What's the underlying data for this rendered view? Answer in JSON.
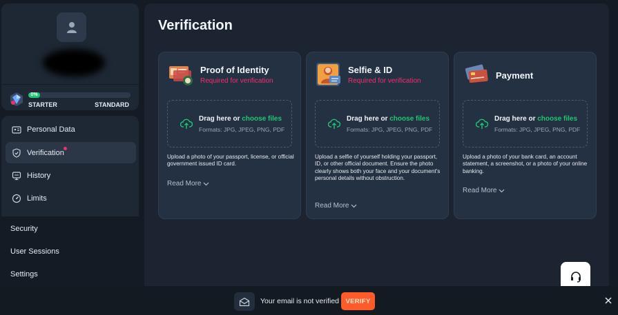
{
  "profile": {
    "level": {
      "progress_label": "0%",
      "progress_fraction": 0.0,
      "start_label": "STARTER",
      "end_label": "STANDARD"
    }
  },
  "sidebar": {
    "items": [
      {
        "label": "Personal Data",
        "icon": "id-card-icon",
        "active": false
      },
      {
        "label": "Verification",
        "icon": "shield-check-icon",
        "active": true
      },
      {
        "label": "History",
        "icon": "monitor-icon",
        "active": false
      },
      {
        "label": "Limits",
        "icon": "gauge-icon",
        "active": false
      }
    ],
    "lower_items": [
      {
        "label": "Security"
      },
      {
        "label": "User Sessions"
      },
      {
        "label": "Settings"
      }
    ]
  },
  "main": {
    "title": "Verification",
    "cards": [
      {
        "title": "Proof of Identity",
        "subtitle": "Required for verification",
        "drag_prefix": "Drag here or ",
        "choose_label": "choose files",
        "formats": "Formats: JPG, JPEG, PNG, PDF",
        "description": "Upload a photo of your passport, license, or official government issued ID card.",
        "read_more": "Read More"
      },
      {
        "title": "Selfie & ID",
        "subtitle": "Required for verification",
        "drag_prefix": "Drag here or ",
        "choose_label": "choose files",
        "formats": "Formats: JPG, JPEG, PNG, PDF",
        "description": "Upload a selfie of yourself holding your passport, ID, or other official document. Ensure the photo clearly shows both your face and your document's personal details without obstruction.",
        "read_more": "Read More"
      },
      {
        "title": "Payment",
        "subtitle": "",
        "drag_prefix": "Drag here or ",
        "choose_label": "choose files",
        "formats": "Formats: JPG, JPEG, PNG, PDF",
        "description": "Upload a photo of your bank card, an account statement, a screenshot, or a photo of your online banking.",
        "read_more": "Read More"
      }
    ]
  },
  "notice": {
    "text": "Your email is not verified",
    "button_label": "VERIFY"
  },
  "colors": {
    "accent_green": "#1ec773",
    "accent_pink": "#f0306e",
    "verify_orange": "#ff5a2a"
  }
}
